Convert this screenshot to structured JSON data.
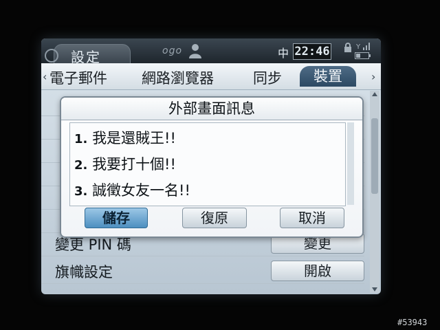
{
  "titlebar": {
    "app_title": "設定",
    "brand": "ogo",
    "ime": "中",
    "clock": "22:46"
  },
  "tabs": [
    {
      "label": "電子郵件",
      "active": false
    },
    {
      "label": "網路瀏覽器",
      "active": false
    },
    {
      "label": "同步",
      "active": false
    },
    {
      "label": "裝置",
      "active": true
    }
  ],
  "settings_list": [
    {
      "label": "變更 PIN 碼",
      "button": "變更"
    },
    {
      "label": "旗幟設定",
      "button": "開啟"
    }
  ],
  "dialog": {
    "title": "外部畫面訊息",
    "lines": [
      {
        "num": "1.",
        "text": "我是還賊王!!"
      },
      {
        "num": "2.",
        "text": "我要打十個!!"
      },
      {
        "num": "3.",
        "text": "誠徵女友一名!!"
      }
    ],
    "buttons": {
      "save": "儲存",
      "restore": "復原",
      "cancel": "取消"
    }
  },
  "watermark": "#53943",
  "colors": {
    "focus_button": "#4d8fc0",
    "active_tab": "#2c4963",
    "titlebar": "#1e262d"
  }
}
